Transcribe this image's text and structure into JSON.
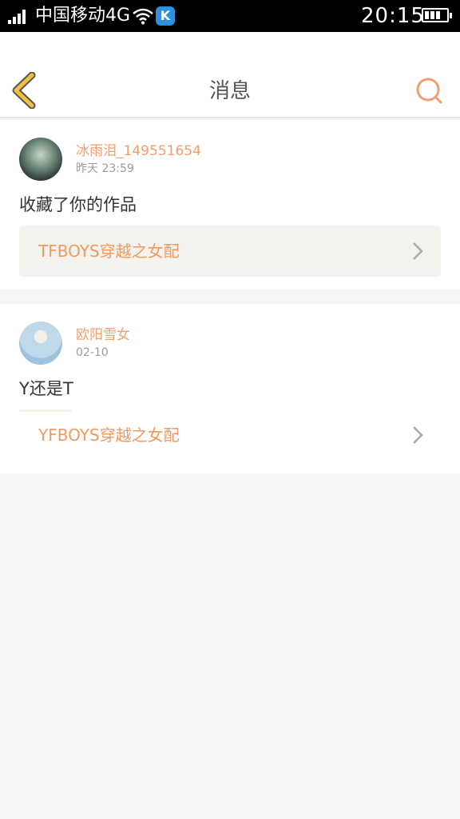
{
  "status_bar": {
    "carrier": "中国移动4G",
    "time": "20:15",
    "app_badge": "K"
  },
  "header": {
    "title": "消息"
  },
  "messages": [
    {
      "username": "冰雨泪_149551654",
      "time": "昨天 23:59",
      "text": "收藏了你的作品",
      "work_title": "TFBOYS穿越之女配"
    },
    {
      "username": "欧阳雪女",
      "time": "02-10",
      "text": "Y还是T",
      "work_title": "YFBOYS穿越之女配"
    }
  ],
  "colors": {
    "accent": "#f0a070",
    "back_icon": "#f0c040",
    "search_icon": "#f0a070",
    "link_bg": "#f3f2ec"
  }
}
